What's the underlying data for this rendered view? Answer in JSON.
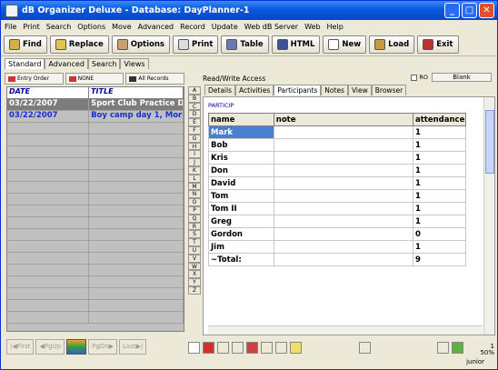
{
  "window": {
    "title": "dB Organizer Deluxe - Database: DayPlanner-1"
  },
  "menu": [
    "File",
    "Print",
    "Search",
    "Options",
    "Move",
    "Advanced",
    "Record",
    "Update",
    "Web dB Server",
    "Web",
    "Help"
  ],
  "toolbar": {
    "find": "Find",
    "replace": "Replace",
    "options": "Options",
    "print": "Print",
    "table": "Table",
    "html": "HTML",
    "new": "New",
    "load": "Load",
    "exit": "Exit"
  },
  "left_tabs": [
    "Standard",
    "Advanced",
    "Search",
    "Views"
  ],
  "sort": {
    "entry_order": "Entry Order",
    "none": "NONE",
    "all_records": "All Records"
  },
  "records": {
    "columns": [
      "DATE",
      "TITLE"
    ],
    "rows": [
      {
        "date": "03/22/2007",
        "title": "Sport Club Practice Da"
      },
      {
        "date": "03/22/2007",
        "title": "Boy camp day 1, Morni"
      }
    ]
  },
  "left_nav": {
    "first": "First",
    "pgup": "PgUp",
    "pgdn": "PgDn",
    "last": "Last"
  },
  "alphabet": [
    "A",
    "B",
    "C",
    "D",
    "E",
    "F",
    "G",
    "H",
    "I",
    "J",
    "K",
    "L",
    "M",
    "N",
    "O",
    "P",
    "Q",
    "R",
    "S",
    "T",
    "U",
    "V",
    "W",
    "X",
    "Y",
    "Z"
  ],
  "rw": {
    "access": "Read/Write Access",
    "ro": "RO",
    "blank": "Blank"
  },
  "right_tabs": [
    "Details",
    "Activities",
    "Participants",
    "Notes",
    "View",
    "Browser"
  ],
  "particip": {
    "label": "PARTICIP",
    "columns": [
      "name",
      "note",
      "attendance"
    ],
    "rows": [
      {
        "name": "Mark",
        "note": "",
        "attendance": "1"
      },
      {
        "name": "Bob",
        "note": "",
        "attendance": "1"
      },
      {
        "name": "Kris",
        "note": "",
        "attendance": "1"
      },
      {
        "name": "Don",
        "note": "",
        "attendance": "1"
      },
      {
        "name": "David",
        "note": "",
        "attendance": "1"
      },
      {
        "name": "Tom",
        "note": "",
        "attendance": "1"
      },
      {
        "name": "Tom II",
        "note": "",
        "attendance": "1"
      },
      {
        "name": "Greg",
        "note": "",
        "attendance": "1"
      },
      {
        "name": "Gordon",
        "note": "",
        "attendance": "0"
      },
      {
        "name": "Jim",
        "note": "",
        "attendance": "1"
      },
      {
        "name": "~Total:",
        "note": "",
        "attendance": "9"
      }
    ]
  },
  "status": {
    "page": "1",
    "zoom": "50%",
    "user": "junior"
  }
}
